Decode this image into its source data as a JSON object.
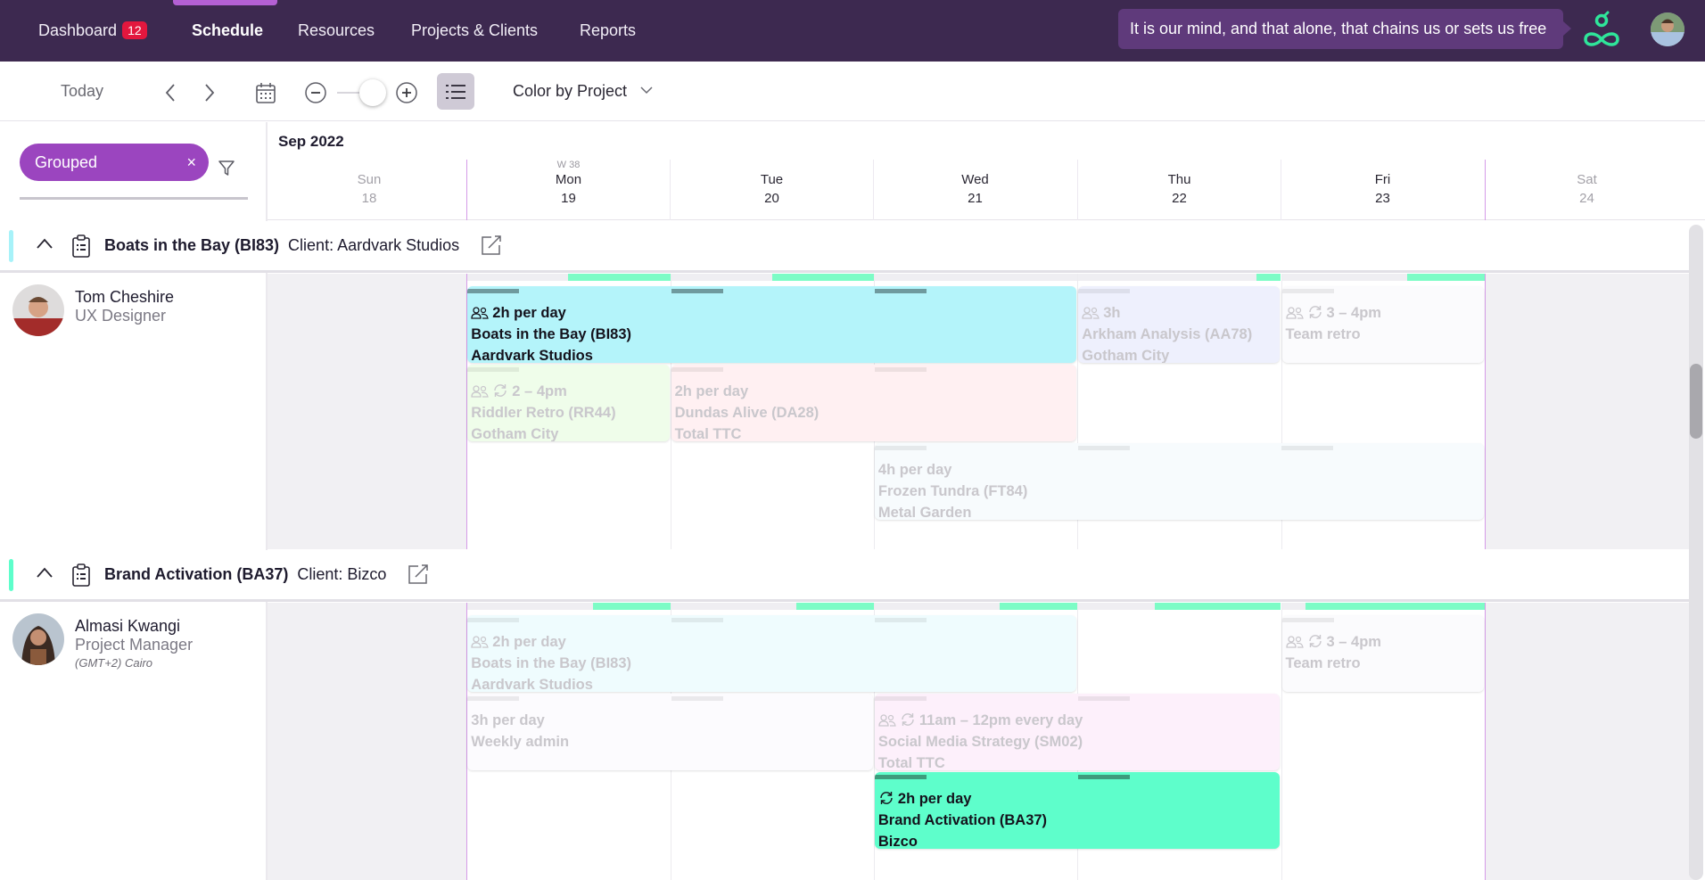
{
  "nav": {
    "items": [
      {
        "label": "Dashboard",
        "badge": "12"
      },
      {
        "label": "Schedule",
        "active": true
      },
      {
        "label": "Resources"
      },
      {
        "label": "Projects & Clients"
      },
      {
        "label": "Reports"
      }
    ],
    "quote": "It is our mind, and that alone, that chains us or sets us free",
    "logo_icon": "infinity-logo-icon",
    "user_avatar": "user-avatar"
  },
  "toolbar": {
    "today_label": "Today",
    "prev_icon": "chevron-left-icon",
    "next_icon": "chevron-right-icon",
    "calendar_icon": "calendar-icon",
    "zoom_out_icon": "minus-circle-icon",
    "zoom_in_icon": "plus-circle-icon",
    "zoom_level_fraction": 0.75,
    "list_view_icon": "list-icon",
    "color_by_label": "Color by Project"
  },
  "filters": {
    "chip_label": "Grouped",
    "chip_close": "×"
  },
  "calendar": {
    "month": "Sep 2022",
    "week_label": "W 38",
    "days": [
      {
        "name": "Sun",
        "date": "18",
        "weekend": true
      },
      {
        "name": "Mon",
        "date": "19",
        "weekend": false
      },
      {
        "name": "Tue",
        "date": "20",
        "weekend": false
      },
      {
        "name": "Wed",
        "date": "21",
        "weekend": false
      },
      {
        "name": "Thu",
        "date": "22",
        "weekend": false
      },
      {
        "name": "Fri",
        "date": "23",
        "weekend": false
      },
      {
        "name": "Sat",
        "date": "24",
        "weekend": true
      }
    ]
  },
  "colors": {
    "nav_bg": "#3d2950",
    "accent_purple": "#9b45bf",
    "badge_red": "#e3173e",
    "capacity_green": "#7dfcc6",
    "boats_cyan": "#b4f4fa",
    "brand_green": "#5efecb"
  },
  "groups": [
    {
      "title": "Boats in the Bay (BI83)",
      "client": "Client: Aardvark Studios",
      "accent": "#a7f2f9",
      "person": {
        "name": "Tom Cheshire",
        "role": "UX Designer",
        "tz": ""
      },
      "capacity": [
        0,
        0.5,
        0.5,
        0,
        0.12,
        0.38,
        0
      ],
      "allocations": [
        {
          "lines": [
            "2h per day",
            "Boats in the Bay (BI83)",
            "Aardvark Studios"
          ],
          "icons": [
            "people"
          ],
          "start": 1,
          "span": 3,
          "row": 0,
          "bg": "#b4f4fa",
          "strong": true
        },
        {
          "lines": [
            "3h",
            "Arkham Analysis (AA78)",
            "Gotham City"
          ],
          "icons": [
            "people"
          ],
          "start": 4,
          "span": 1,
          "row": 0,
          "bg": "#eef0fd",
          "strong": false
        },
        {
          "lines": [
            "3 – 4pm",
            "Team retro"
          ],
          "icons": [
            "people",
            "repeat"
          ],
          "start": 5,
          "span": 1,
          "row": 0,
          "bg": "#fbfbfd",
          "strong": false
        },
        {
          "lines": [
            "2 – 4pm",
            "Riddler Retro (RR44)",
            "Gotham City"
          ],
          "icons": [
            "people",
            "repeat"
          ],
          "start": 1,
          "span": 1,
          "row": 1,
          "bg": "#effdea",
          "strong": false
        },
        {
          "lines": [
            "2h per day",
            "Dundas Alive (DA28)",
            "Total TTC"
          ],
          "icons": [],
          "start": 2,
          "span": 2,
          "row": 1,
          "bg": "#fff0f2",
          "strong": false
        },
        {
          "lines": [
            "4h per day",
            "Frozen Tundra (FT84)",
            "Metal Garden"
          ],
          "icons": [],
          "start": 3,
          "span": 3,
          "row": 2,
          "bg": "#f7fbfd",
          "strong": false
        }
      ]
    },
    {
      "title": "Brand Activation (BA37)",
      "client": "Client: Bizco",
      "accent": "#5efecb",
      "person": {
        "name": "Almasi Kwangi",
        "role": "Project Manager",
        "tz": "(GMT+2) Cairo"
      },
      "capacity": [
        0,
        0.38,
        0.38,
        0.38,
        0.62,
        0.88,
        0
      ],
      "allocations": [
        {
          "lines": [
            "2h per day",
            "Boats in the Bay (BI83)",
            "Aardvark Studios"
          ],
          "icons": [
            "people"
          ],
          "start": 1,
          "span": 3,
          "row": 0,
          "bg": "#effcfe",
          "strong": false
        },
        {
          "lines": [
            "3 – 4pm",
            "Team retro"
          ],
          "icons": [
            "people",
            "repeat"
          ],
          "start": 5,
          "span": 1,
          "row": 0,
          "bg": "#fbfbfd",
          "strong": false
        },
        {
          "lines": [
            "3h per day",
            "Weekly admin"
          ],
          "icons": [],
          "start": 1,
          "span": 2,
          "row": 1,
          "bg": "#fcfbfe",
          "strong": false
        },
        {
          "lines": [
            "11am – 12pm every day",
            "Social Media Strategy (SM02)",
            "Total TTC"
          ],
          "icons": [
            "people",
            "repeat"
          ],
          "start": 3,
          "span": 2,
          "row": 1,
          "bg": "#fdf0fb",
          "strong": false
        },
        {
          "lines": [
            "2h per day",
            "Brand Activation (BA37)",
            "Bizco"
          ],
          "icons": [
            "repeat"
          ],
          "start": 3,
          "span": 2,
          "row": 2,
          "bg": "#5efecb",
          "strong": true
        }
      ]
    }
  ]
}
